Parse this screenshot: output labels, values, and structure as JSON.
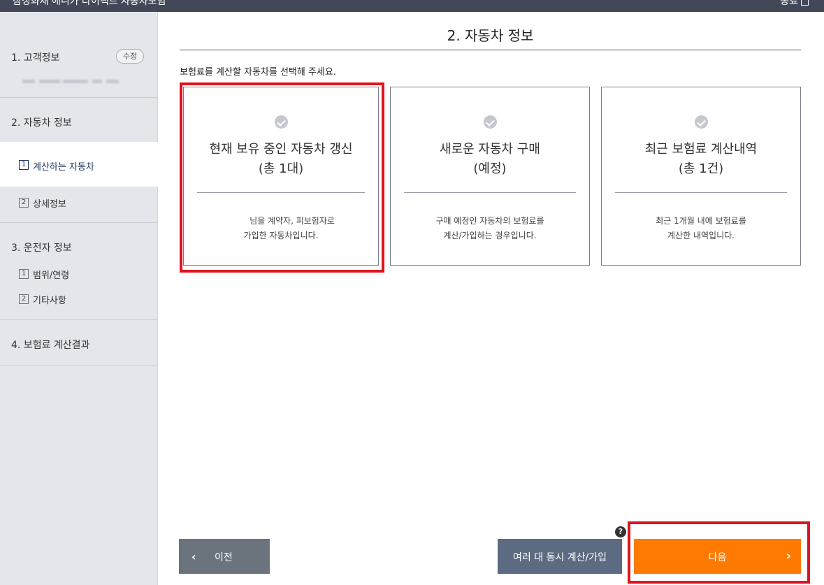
{
  "window": {
    "title": "삼성화재 애니카 다이렉트 자동차보험",
    "close_label": "종료"
  },
  "sidebar": {
    "sections": [
      {
        "label": "1. 고객정보",
        "edit_label": "수정"
      },
      {
        "label": "2. 자동차 정보"
      },
      {
        "label": "3. 운전자 정보"
      },
      {
        "label": "4. 보험료 계산결과"
      }
    ],
    "vehicle_items": [
      {
        "num": "1",
        "label": "계산하는 자동차",
        "active": true
      },
      {
        "num": "2",
        "label": "상세정보",
        "active": false
      }
    ],
    "driver_items": [
      {
        "num": "1",
        "label": "범위/연령"
      },
      {
        "num": "2",
        "label": "기타사항"
      }
    ]
  },
  "main": {
    "title": "2. 자동차 정보",
    "instruction": "보험료를 계산할 자동차를 선택해 주세요.",
    "cards": [
      {
        "title": "현재 보유 중인 자동차 갱신",
        "subtitle": "(총 1대)",
        "desc1": "님을 계약자, 피보험자로",
        "desc2": "가입한 자동차입니다.",
        "highlighted": true
      },
      {
        "title": "새로운 자동차 구매",
        "subtitle": "(예정)",
        "desc1": "구매 예정인 자동차의 보험료를",
        "desc2": "계산/가입하는 경우입니다.",
        "highlighted": false
      },
      {
        "title": "최근 보험료 계산내역",
        "subtitle": "(총 1건)",
        "desc1": "최근 1개월 내에 보험료를",
        "desc2": "계산한 내역입니다.",
        "highlighted": false
      }
    ]
  },
  "footer": {
    "prev_label": "이전",
    "multi_label": "여러 대 동시 계산/가입",
    "help_label": "?",
    "next_label": "다음"
  },
  "colors": {
    "topbar": "#424858",
    "sidebar_bg": "#e3e6ea",
    "next_button": "#ff7a00",
    "multi_button": "#5d6b82",
    "prev_button": "#6b737c",
    "highlight": "#e0141e"
  },
  "icons": [
    "check-icon",
    "chevron-left-icon",
    "chevron-right-icon",
    "help-icon",
    "close-icon"
  ]
}
